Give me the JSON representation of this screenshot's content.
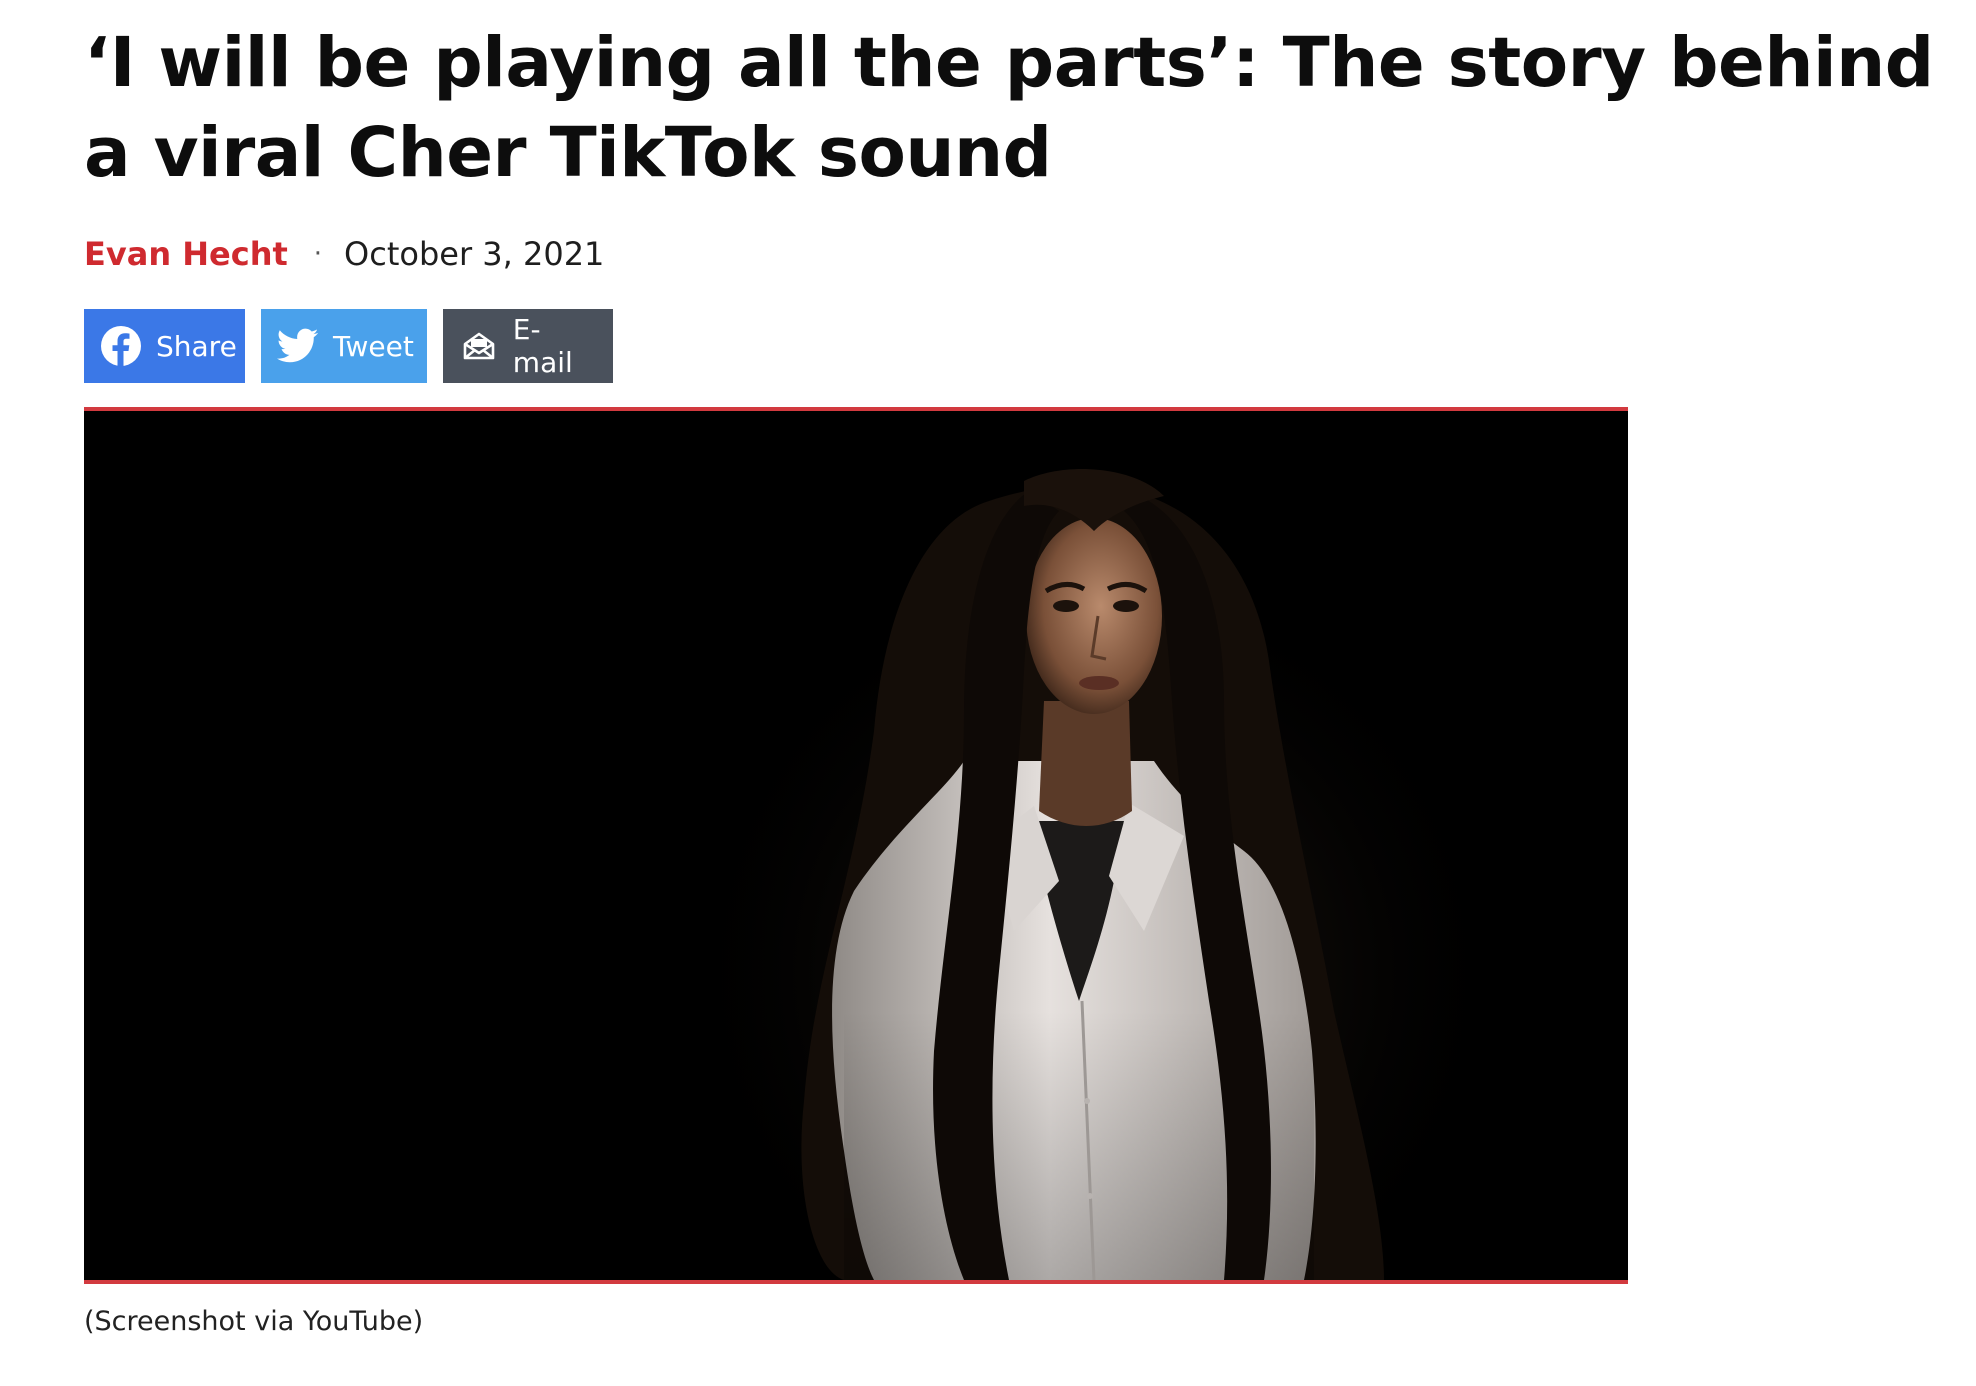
{
  "article": {
    "headline": "‘I will be playing all the parts’: The story behind a viral Cher TikTok sound",
    "author": "Evan Hecht",
    "separator": "·",
    "date": "October 3, 2021",
    "image_caption": "(Screenshot via YouTube)"
  },
  "share": {
    "facebook": {
      "label": "Share",
      "icon": "facebook-icon",
      "color": "#3b78e7"
    },
    "twitter": {
      "label": "Tweet",
      "icon": "twitter-bird-icon",
      "color": "#4aa1eb"
    },
    "email": {
      "label": "E-mail",
      "icon": "envelope-icon",
      "color": "#4a515c"
    }
  },
  "colors": {
    "accent": "#cf2a2f",
    "media_border": "#d23a3f"
  }
}
